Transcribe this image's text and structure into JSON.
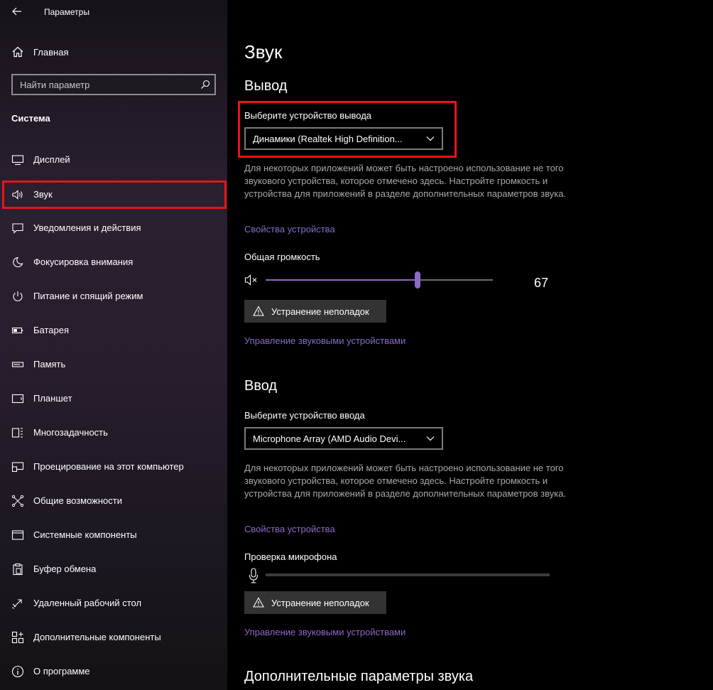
{
  "window": {
    "title": "Параметры"
  },
  "sidebar": {
    "home_label": "Главная",
    "search_placeholder": "Найти параметр",
    "section_title": "Система",
    "items": [
      {
        "label": "Дисплей",
        "icon": "display-icon"
      },
      {
        "label": "Звук",
        "icon": "speaker-icon",
        "selected": true
      },
      {
        "label": "Уведомления и действия",
        "icon": "notifications-icon"
      },
      {
        "label": "Фокусировка внимания",
        "icon": "moon-icon"
      },
      {
        "label": "Питание и спящий режим",
        "icon": "power-icon"
      },
      {
        "label": "Батарея",
        "icon": "battery-icon"
      },
      {
        "label": "Память",
        "icon": "storage-icon"
      },
      {
        "label": "Планшет",
        "icon": "tablet-icon"
      },
      {
        "label": "Многозадачность",
        "icon": "multitasking-icon"
      },
      {
        "label": "Проецирование на этот компьютер",
        "icon": "projecting-icon"
      },
      {
        "label": "Общие возможности",
        "icon": "shared-experiences-icon"
      },
      {
        "label": "Системные компоненты",
        "icon": "system-components-icon"
      },
      {
        "label": "Буфер обмена",
        "icon": "clipboard-icon"
      },
      {
        "label": "Удаленный рабочий стол",
        "icon": "remote-desktop-icon"
      },
      {
        "label": "Дополнительные компоненты",
        "icon": "optional-features-icon"
      },
      {
        "label": "О программе",
        "icon": "info-icon"
      }
    ]
  },
  "main": {
    "page_title": "Звук",
    "output": {
      "heading": "Вывод",
      "device_label": "Выберите устройство вывода",
      "device_value": "Динамики (Realtek High Definition...",
      "description": "Для некоторых приложений может быть настроено использование не того звукового устройства, которое отмечено здесь. Настройте громкость и устройства для приложений в разделе дополнительных параметров звука.",
      "properties_link": "Свойства устройства",
      "volume_label": "Общая громкость",
      "volume_value": 67,
      "volume_text": "67",
      "troubleshoot_label": "Устранение неполадок",
      "manage_link": "Управление звуковыми устройствами"
    },
    "input": {
      "heading": "Ввод",
      "device_label": "Выберите устройство ввода",
      "device_value": "Microphone Array (AMD Audio Devi...",
      "description": "Для некоторых приложений может быть настроено использование не того звукового устройства, которое отмечено здесь. Настройте громкость и устройства для приложений в разделе дополнительных параметров звука.",
      "properties_link": "Свойства устройства",
      "mic_test_label": "Проверка микрофона",
      "mic_level": 0,
      "troubleshoot_label": "Устранение неполадок",
      "manage_link": "Управление звуковыми устройствами"
    },
    "advanced_heading": "Дополнительные параметры звука"
  },
  "colors": {
    "accent": "#8a6bc9",
    "highlight": "#e8131a"
  }
}
